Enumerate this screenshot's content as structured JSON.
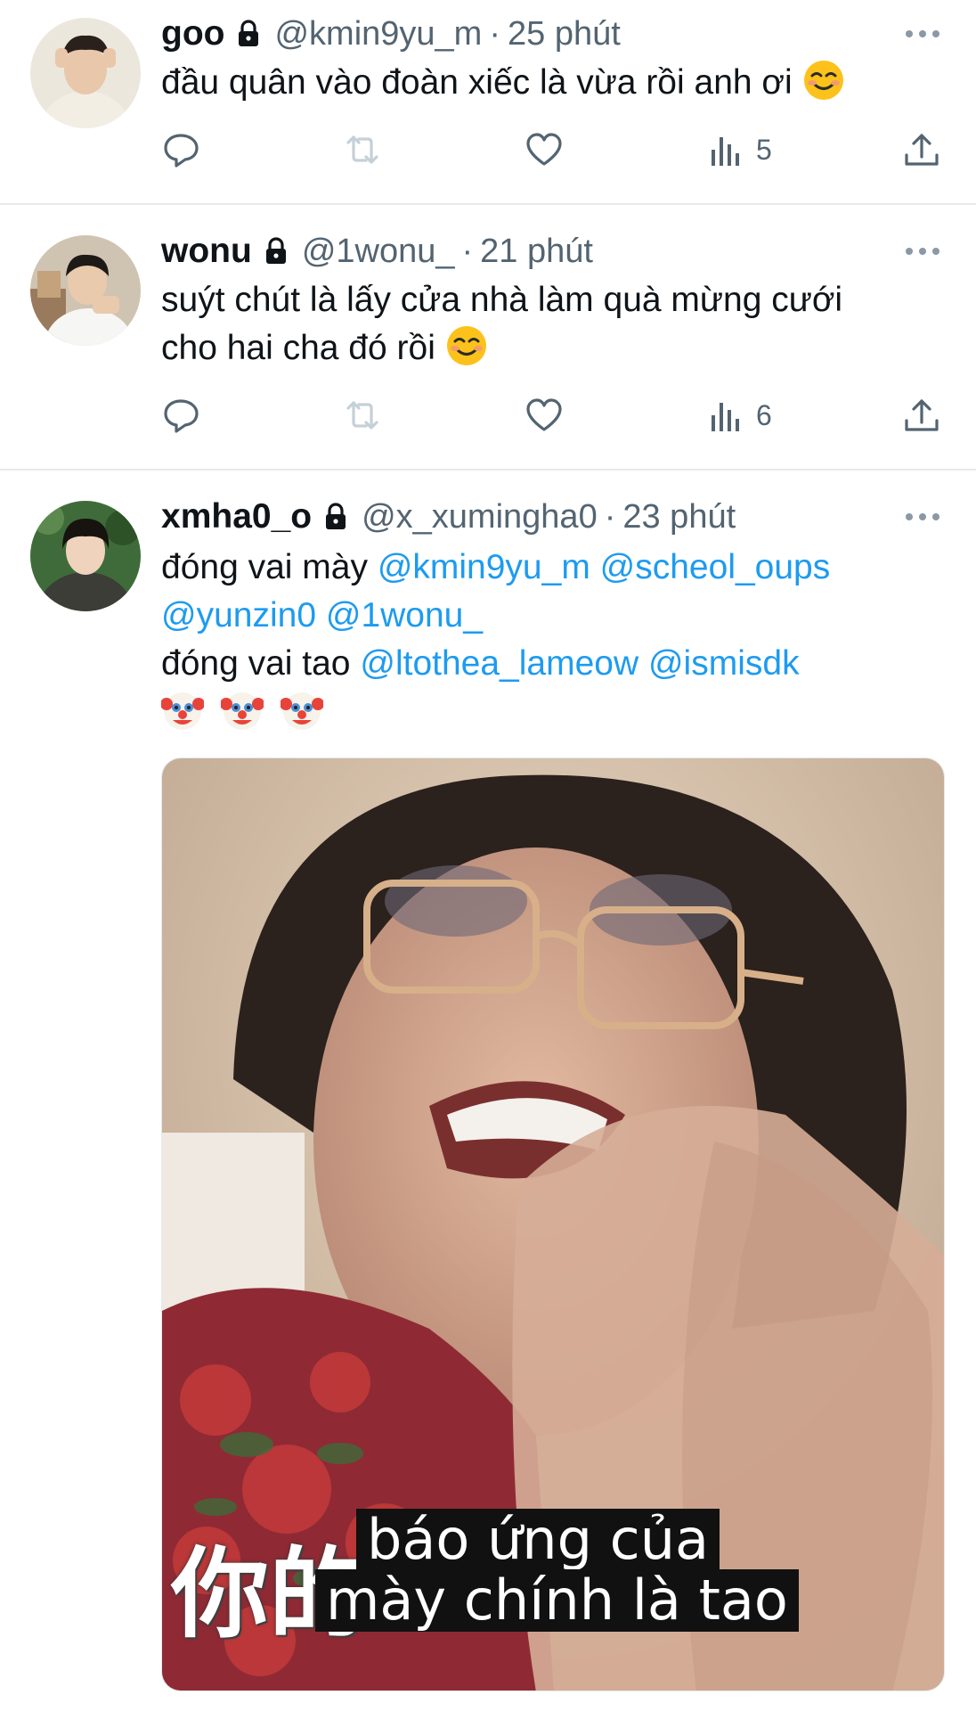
{
  "tweets": [
    {
      "name": "goo",
      "handle": "@kmin9yu_m",
      "separator": "·",
      "time": "25 phút",
      "text": "đầu quân vào đoàn xiếc là vừa rồi anh ơi",
      "views": "5"
    },
    {
      "name": "wonu",
      "handle": "@1wonu_",
      "separator": "·",
      "time": "21 phút",
      "text_line1": "suýt chút là lấy cửa nhà làm quà mừng cưới",
      "text_line2": "cho hai cha đó rồi",
      "views": "6"
    },
    {
      "name": "xmha0_o",
      "handle": "@x_xumingha0",
      "separator": "·",
      "time": "23 phút",
      "line1_prefix": "đóng vai mày",
      "line1_mentions": [
        "@kmin9yu_m",
        "@scheol_oups"
      ],
      "line2_mentions": [
        "@yunzin0",
        "@1wonu_"
      ],
      "line3_prefix": "đóng vai tao",
      "line3_mentions": [
        "@ltothea_lameow",
        "@ismisdk"
      ],
      "media": {
        "caption_line1": "báo ứng của",
        "caption_line2": "mày chính là tao",
        "overlay_cn": "你的+"
      }
    }
  ],
  "icons": {
    "reply": "reply-icon",
    "retweet": "retweet-icon",
    "like": "heart-icon",
    "views": "views-icon",
    "share": "share-icon",
    "more": "more-icon",
    "lock": "lock-icon",
    "emoji_smile": "smiling-face-icon",
    "emoji_clown": "clown-face-icon"
  },
  "colors": {
    "text": "#0f1419",
    "secondary": "#536471",
    "mention": "#1d9bf0",
    "divider": "#e6e9ec",
    "retweet_disabled": "#c5d0d7"
  }
}
